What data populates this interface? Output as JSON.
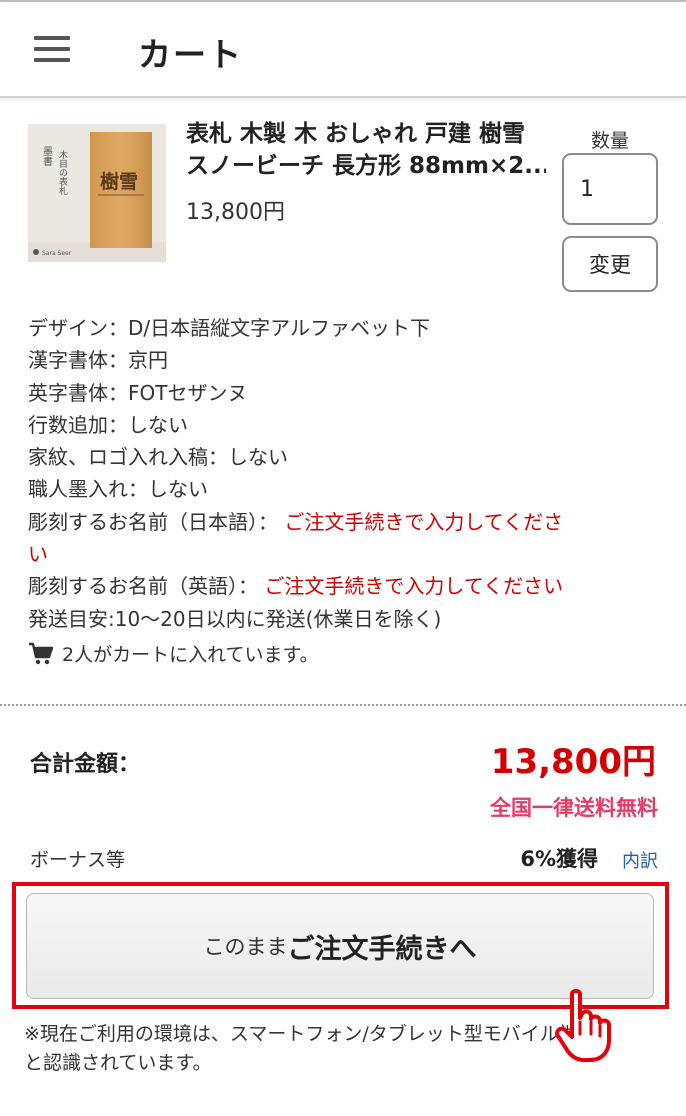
{
  "header": {
    "title": "カート"
  },
  "product": {
    "name_line1": "表札 木製 木 おしゃれ 戸建 樹雪",
    "name_line2": "スノービーチ 長方形 88mm×2...",
    "price": "13,800円",
    "thumbnail": {
      "vertical_text_1": "墨書",
      "vertical_text_2": "木目の表札",
      "plate_text": "樹雪",
      "brand": "Sara Seer"
    }
  },
  "quantity": {
    "label": "数量",
    "value": "1",
    "change_label": "変更"
  },
  "options": {
    "design": "デザイン：D/日本語縦文字アルファベット下",
    "kanji_font": "漢字書体：京円",
    "alpha_font": "英字書体：FOTセザンヌ",
    "add_lines": "行数追加：しない",
    "crest": "家紋、ロゴ入れ入稿：しない",
    "ink": "職人墨入れ：しない",
    "name_jp_label": "彫刻するお名前（日本語）：",
    "name_jp_note_1": "ご注文手続きで入力してくださ",
    "name_jp_note_2": "い",
    "name_en_label": "彫刻するお名前（英語）：",
    "name_en_note": "ご注文手続きで入力してください",
    "shipping_estimate": "発送目安:10〜20日以内に発送(休業日を除く)"
  },
  "popularity": {
    "text": "2人がカートに入れています。",
    "icon": "cart-icon"
  },
  "summary": {
    "total_label": "合計金額：",
    "total_price": "13,800円",
    "shipping_note": "全国一律送料無料",
    "bonus_label": "ボーナス等",
    "bonus_value": "6%獲得",
    "bonus_link": "内訳"
  },
  "order_button": {
    "prefix": "このまま",
    "main": "ご注文手続きへ"
  },
  "footnote": {
    "line1": "※現在ご利用の環境は、スマートフォン/タブレット型モバイル端末",
    "line2": "と認識されています。"
  },
  "colors": {
    "accent_red": "#d40000",
    "shipping_pink": "#e83a66",
    "link_blue": "#1a5cc8",
    "highlight_red": "#e5000a"
  }
}
